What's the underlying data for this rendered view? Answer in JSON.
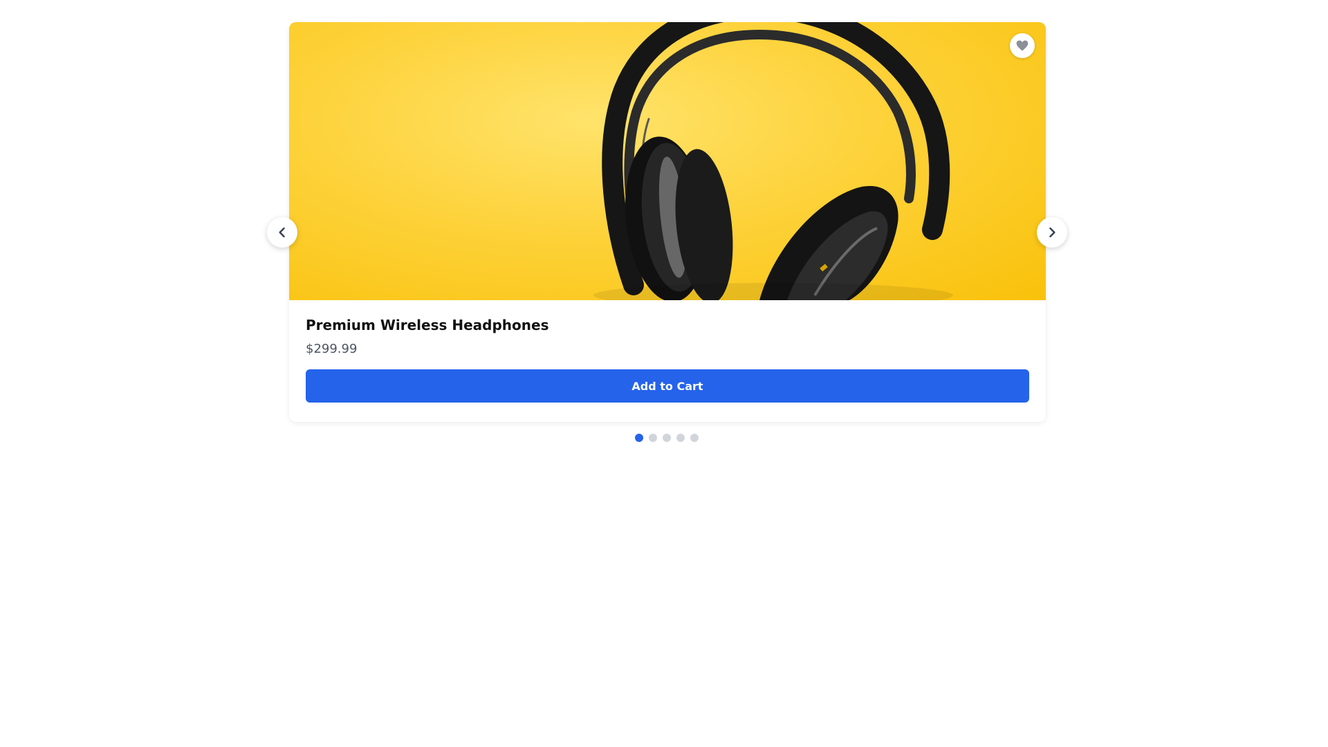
{
  "product": {
    "title": "Premium Wireless Headphones",
    "price": "$299.99",
    "add_to_cart_label": "Add to Cart"
  },
  "carousel": {
    "slide_count": 5,
    "active_index": 0
  },
  "icons": {
    "favorite": "heart-icon",
    "previous": "chevron-left-icon",
    "next": "chevron-right-icon"
  },
  "colors": {
    "accent": "#2563eb",
    "dot_inactive": "#d1d5db",
    "hero_background": "#fdd23a"
  }
}
